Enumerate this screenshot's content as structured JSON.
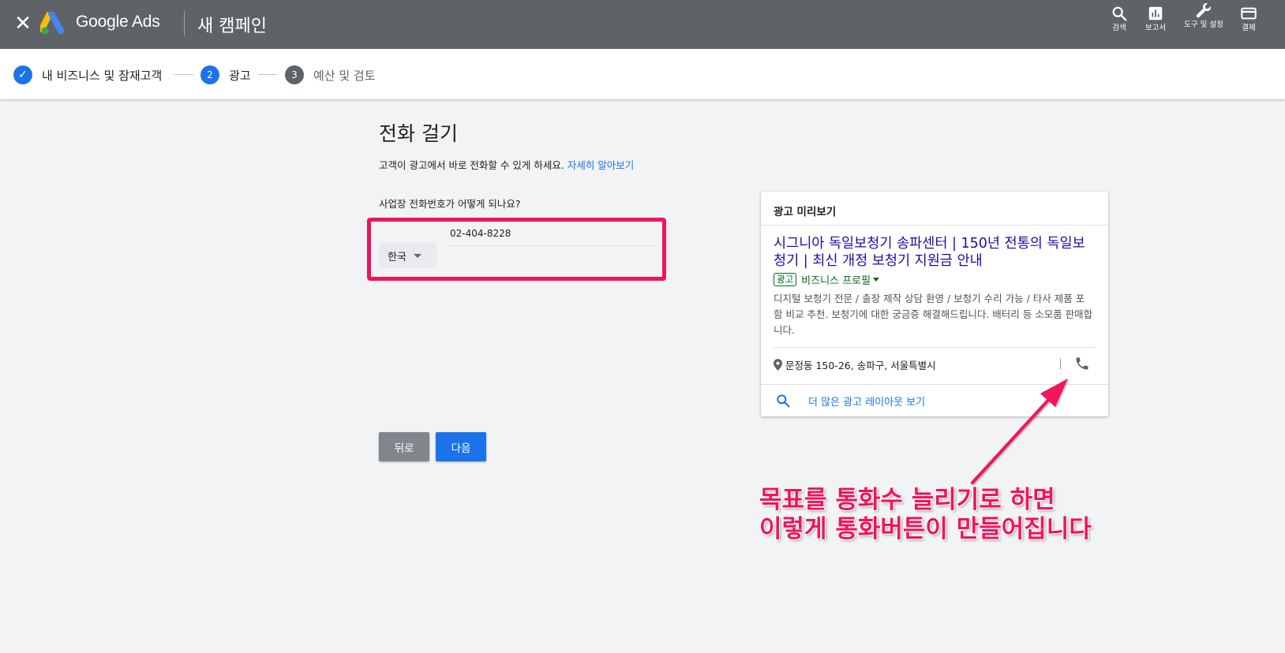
{
  "header": {
    "close_label": "✕",
    "brand": "Google Ads",
    "title": "새 캠페인",
    "tools": [
      {
        "label": "검색",
        "icon": "search-icon"
      },
      {
        "label": "보고서",
        "icon": "bar-chart-icon"
      },
      {
        "label": "도구 및 설정",
        "icon": "wrench-icon"
      },
      {
        "label": "결제",
        "icon": "credit-card-icon"
      }
    ]
  },
  "stepper": {
    "steps": [
      {
        "number": "✓",
        "label": "내 비즈니스 및 잠재고객",
        "state": "completed"
      },
      {
        "number": "2",
        "label": "광고",
        "state": "active"
      },
      {
        "number": "3",
        "label": "예산 및 검토",
        "state": "pending"
      }
    ]
  },
  "main": {
    "title": "전화 걸기",
    "description": "고객이 광고에서 바로 전화할 수 있게 하세요.",
    "learn_more": "자세히 알아보기",
    "phone_question": "사업장 전화번호가 어떻게 되나요?",
    "country": "한국",
    "phone_value": "02-404-8228",
    "back_label": "뒤로",
    "next_label": "다음"
  },
  "preview": {
    "heading": "광고 미리보기",
    "headline": "시그니아 독일보청기 송파센터 | 150년 전통의 독일보청기 | 최신 개정 보청기 지원금 안내",
    "ad_badge": "광고",
    "display_url": "비즈니스 프로필",
    "description": "디지털 보청기 전문 / 출장 제작 상담 환영 / 보청기 수리 가능 / 타사 제품 포함 비교 추천. 보청기에 대한 궁금증 해결해드립니다. 배터리 등 소모품 판매합니다.",
    "location": "문정동 150-26, 송파구, 서울특별시",
    "more_layouts": "더 많은 광고 레이아웃 보기"
  },
  "annotation": {
    "line1": "목표를 통화수 늘리기로 하면",
    "line2": "이렇게 통화버튼이 만들어집니다"
  },
  "colors": {
    "header_bg": "#5f6368",
    "accent_blue": "#1a73e8",
    "highlight_pink": "#f0145a",
    "step_pending": "#5f6368",
    "ad_green": "#006621",
    "ad_link": "#1a0dab"
  }
}
